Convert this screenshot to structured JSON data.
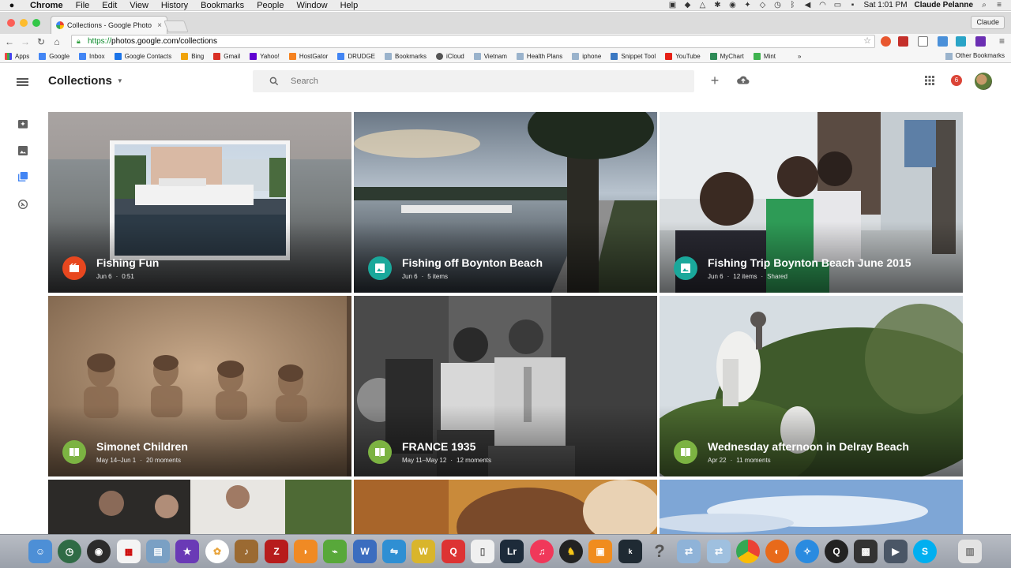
{
  "menubar": {
    "app": "Chrome",
    "menus": [
      "File",
      "Edit",
      "View",
      "History",
      "Bookmarks",
      "People",
      "Window",
      "Help"
    ],
    "clock": "Sat 1:01 PM",
    "user": "Claude Pelanne"
  },
  "browser": {
    "tab_title": "Collections - Google Photo",
    "tab_close": "×",
    "profile": "Claude",
    "url_scheme": "https://",
    "url_rest": "photos.google.com/collections"
  },
  "bookmarks": {
    "items": [
      "Apps",
      "Google",
      "Inbox",
      "Google Contacts",
      "Bing",
      "Gmail",
      "Yahoo!",
      "HostGator",
      "DRUDGE",
      "Bookmarks",
      "iCloud",
      "Vietnam",
      "Health Plans",
      "iphone",
      "Snippet Tool",
      "YouTube",
      "MyChart",
      "Mint"
    ],
    "overflow": "»",
    "other": "Other Bookmarks"
  },
  "header": {
    "title": "Collections",
    "search_placeholder": "Search",
    "notification_count": "6"
  },
  "collections": [
    {
      "title": "Fishing Fun",
      "date": "Jun 6",
      "detail": "0:51",
      "extra": "",
      "kind": "movie",
      "color": "#e8471f"
    },
    {
      "title": "Fishing off Boynton Beach",
      "date": "Jun 6",
      "detail": "5 items",
      "extra": "",
      "kind": "album",
      "color": "#1aa89b"
    },
    {
      "title": "Fishing Trip Boynton Beach June 2015",
      "date": "Jun 6",
      "detail": "12 items",
      "extra": "Shared",
      "kind": "album",
      "color": "#1aa89b"
    },
    {
      "title": "Simonet Children",
      "date": "May 14–Jun 1",
      "detail": "20 moments",
      "extra": "",
      "kind": "story",
      "color": "#7cb342"
    },
    {
      "title": "FRANCE 1935",
      "date": "May 11–May 12",
      "detail": "12 moments",
      "extra": "",
      "kind": "story",
      "color": "#7cb342"
    },
    {
      "title": "Wednesday afternoon in Delray Beach",
      "date": "Apr 22",
      "detail": "11 moments",
      "extra": "",
      "kind": "story",
      "color": "#7cb342"
    }
  ],
  "colors": {
    "accent_red": "#db4437",
    "movie": "#e8471f",
    "album": "#1aa89b",
    "story": "#7cb342",
    "search_bg": "#f1f1f1"
  }
}
